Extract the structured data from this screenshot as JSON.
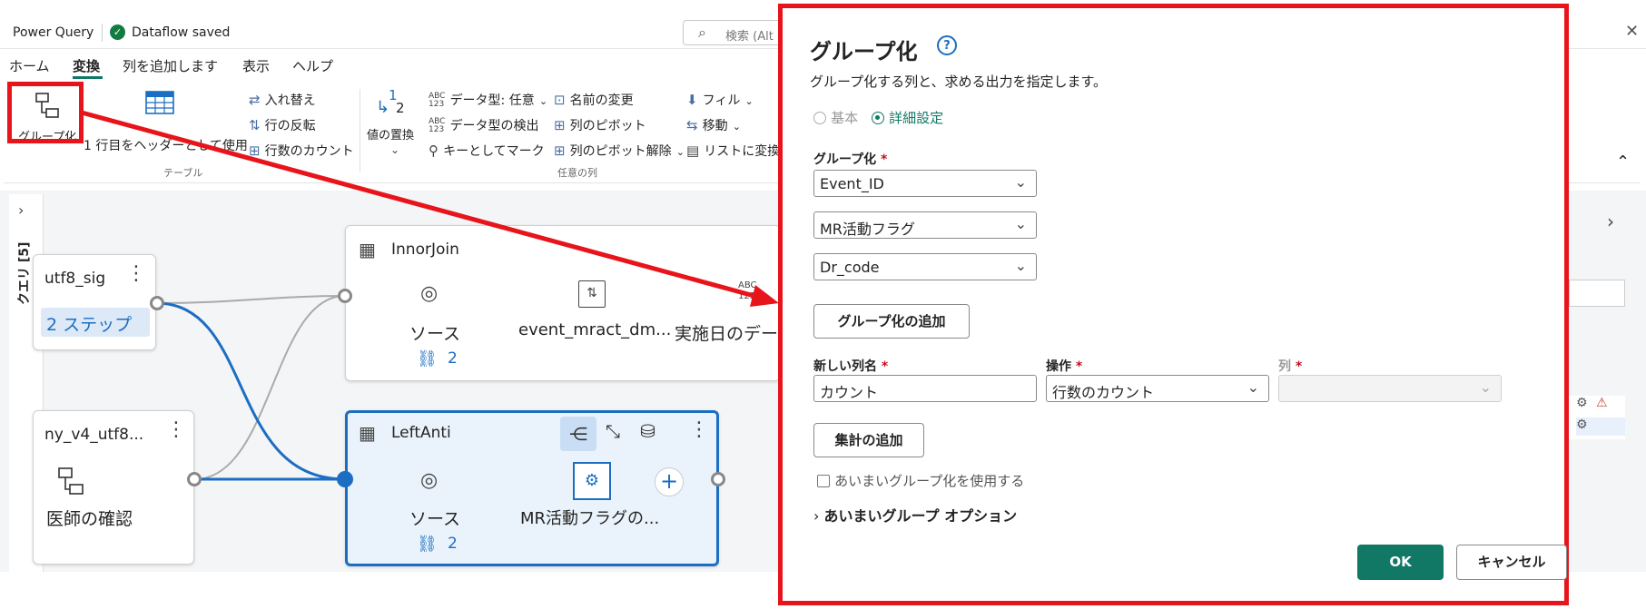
{
  "titlebar": {
    "app_title": "Power Query",
    "saved_status": "Dataflow saved",
    "search_placeholder": "検索 (Alt"
  },
  "menu": {
    "tabs": [
      "ホーム",
      "変換",
      "列を追加します",
      "表示",
      "ヘルプ"
    ],
    "active_tab": "変換"
  },
  "ribbon": {
    "group_by": "グループ化",
    "use_first_row": "1 行目をヘッダーとして使用",
    "table_group": "テーブル",
    "transpose": "入れ替え",
    "reverse_rows": "行の反転",
    "count_rows": "行数のカウント",
    "replace_values_line1": "1",
    "replace_values_line2": "2",
    "replace_values": "値の置換",
    "data_type": "データ型: 任意",
    "detect_type": "データ型の検出",
    "mark_as_key": "キーとしてマーク",
    "rename": "名前の変更",
    "pivot": "列のピボット",
    "unpivot": "列のピボット解除",
    "any_column_group": "任意の列",
    "fill": "フィル",
    "move": "移動",
    "to_list": "リストに変換",
    "abc_label": "ABC",
    "num_label": "123"
  },
  "sidebar": {
    "queries_label": "クエリ [5]"
  },
  "diagram": {
    "card_utf8": {
      "title": "utf8_sig",
      "steps": "2 ステップ"
    },
    "card_v4": {
      "title": "ny_v4_utf8...",
      "step": "医師の確認"
    },
    "card_innor": {
      "title": "InnorJoin",
      "step1": "ソース",
      "step2": "event_mract_dm...",
      "step3": "実施日のデー",
      "link_count": "2",
      "abc": "ABC",
      "num": "123"
    },
    "card_leftanti": {
      "title": "LeftAnti",
      "step1": "ソース",
      "step2": "MR活動フラグの...",
      "link_count": "2"
    }
  },
  "dialog": {
    "title": "グループ化",
    "subtitle": "グループ化する列と、求める出力を指定します。",
    "radio_basic": "基本",
    "radio_advanced": "詳細設定",
    "selected_mode": "詳細設定",
    "group_by_label": "グループ化",
    "required_mark": "*",
    "group_by_fields": [
      "Event_ID",
      "MR活動フラグ",
      "Dr_code"
    ],
    "add_grouping": "グループ化の追加",
    "new_column_label": "新しい列名",
    "new_column_value": "カウント",
    "operation_label": "操作",
    "operation_value": "行数のカウント",
    "column_label": "列",
    "add_aggregation": "集計の追加",
    "fuzzy_checkbox": "あいまいグループ化を使用する",
    "fuzzy_options": "あいまいグループ オプション",
    "ok": "OK",
    "cancel": "キャンセル"
  },
  "colors": {
    "accent": "#117865",
    "link_blue": "#1b6ec2",
    "annotation_red": "#e8141b"
  }
}
